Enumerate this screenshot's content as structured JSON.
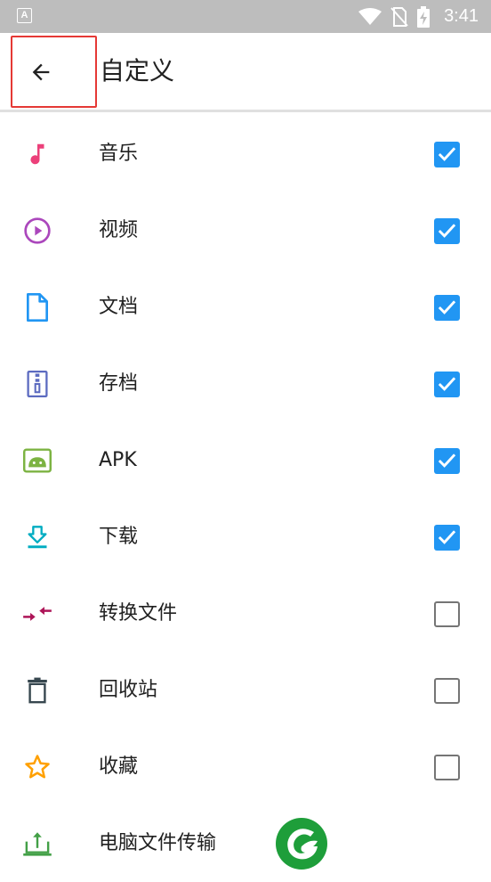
{
  "status_bar": {
    "time": "3:41",
    "notification_icon": "a-letter-icon",
    "icons": [
      "wifi-icon",
      "no-sim-icon",
      "battery-charging-icon"
    ]
  },
  "toolbar": {
    "title": "自定义",
    "back_icon": "arrow-left-icon"
  },
  "items": [
    {
      "label": "音乐",
      "icon": "music-note-icon",
      "color": "#ec407a",
      "checked": true
    },
    {
      "label": "视频",
      "icon": "play-circle-icon",
      "color": "#ab47bc",
      "checked": true
    },
    {
      "label": "文档",
      "icon": "document-icon",
      "color": "#2196f3",
      "checked": true
    },
    {
      "label": "存档",
      "icon": "archive-zip-icon",
      "color": "#5c6bc0",
      "checked": true
    },
    {
      "label": "APK",
      "icon": "android-icon",
      "color": "#7cb342",
      "checked": true
    },
    {
      "label": "下载",
      "icon": "download-icon",
      "color": "#00acc1",
      "checked": true
    },
    {
      "label": "转换文件",
      "icon": "transfer-arrows-icon",
      "color": "#ad1457",
      "checked": false
    },
    {
      "label": "回收站",
      "icon": "trash-icon",
      "color": "#37474f",
      "checked": false
    },
    {
      "label": "收藏",
      "icon": "star-outline-icon",
      "color": "#ffa000",
      "checked": false
    },
    {
      "label": "电脑文件传输",
      "icon": "pc-upload-icon",
      "color": "#43a047",
      "checked": null
    }
  ],
  "colors": {
    "checkbox_checked": "#2196f3",
    "checkbox_unchecked_border": "#757575",
    "highlight_box": "#e53935",
    "status_bar": "#bdbdbd"
  }
}
